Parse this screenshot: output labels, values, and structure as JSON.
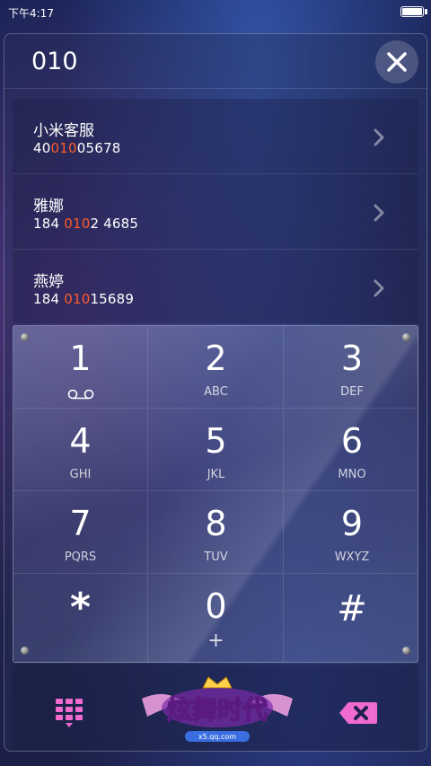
{
  "status_bar": {
    "time": "下午4:17"
  },
  "search": {
    "value": "010"
  },
  "results": [
    {
      "name": "小米客服",
      "num_before": "40",
      "num_match": "010",
      "num_after": "05678"
    },
    {
      "name": "雅娜",
      "num_before": "184 ",
      "num_match": "010",
      "num_after": "2 4685"
    },
    {
      "name": "燕婷",
      "num_before": "184 ",
      "num_match": "010",
      "num_after": "15689"
    }
  ],
  "keypad": [
    {
      "digit": "1",
      "letters": ""
    },
    {
      "digit": "2",
      "letters": "ABC"
    },
    {
      "digit": "3",
      "letters": "DEF"
    },
    {
      "digit": "4",
      "letters": "GHI"
    },
    {
      "digit": "5",
      "letters": "JKL"
    },
    {
      "digit": "6",
      "letters": "MNO"
    },
    {
      "digit": "7",
      "letters": "PQRS"
    },
    {
      "digit": "8",
      "letters": "TUV"
    },
    {
      "digit": "9",
      "letters": "WXYZ"
    },
    {
      "digit": "*",
      "letters": ""
    },
    {
      "digit": "0",
      "letters": "+"
    },
    {
      "digit": "#",
      "letters": ""
    }
  ],
  "bottom": {
    "logo_text": "炫舞时代",
    "logo_sub": "x5.qq.com"
  },
  "colors": {
    "match": "#ff5a2a",
    "accent": "#ff6fc8"
  },
  "icons": [
    "voicemail-icon",
    "close-icon",
    "chevron-right-icon",
    "dialpad-icon",
    "backspace-icon"
  ]
}
